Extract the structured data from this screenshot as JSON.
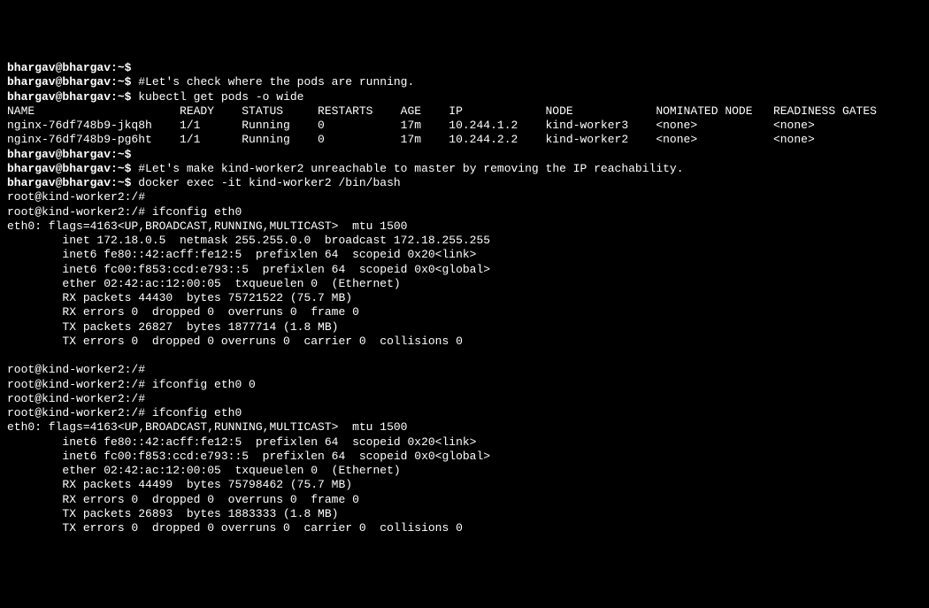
{
  "lines": [
    {
      "type": "prompt",
      "text": "bhargav@bhargav:~$"
    },
    {
      "type": "prompt-cmd",
      "prompt": "bhargav@bhargav:~$",
      "cmd": " #Let's check where the pods are running."
    },
    {
      "type": "prompt-cmd",
      "prompt": "bhargav@bhargav:~$",
      "cmd": " kubectl get pods -o wide"
    },
    {
      "type": "output",
      "text": "NAME                     READY    STATUS     RESTARTS    AGE    IP            NODE            NOMINATED NODE   READINESS GATES"
    },
    {
      "type": "output",
      "text": "nginx-76df748b9-jkq8h    1/1      Running    0           17m    10.244.1.2    kind-worker3    <none>           <none>"
    },
    {
      "type": "output",
      "text": "nginx-76df748b9-pg6ht    1/1      Running    0           17m    10.244.2.2    kind-worker2    <none>           <none>"
    },
    {
      "type": "prompt",
      "text": "bhargav@bhargav:~$"
    },
    {
      "type": "prompt-cmd",
      "prompt": "bhargav@bhargav:~$",
      "cmd": " #Let's make kind-worker2 unreachable to master by removing the IP reachability."
    },
    {
      "type": "prompt-cmd",
      "prompt": "bhargav@bhargav:~$",
      "cmd": " docker exec -it kind-worker2 /bin/bash"
    },
    {
      "type": "output",
      "text": "root@kind-worker2:/#"
    },
    {
      "type": "output",
      "text": "root@kind-worker2:/# ifconfig eth0"
    },
    {
      "type": "output",
      "text": "eth0: flags=4163<UP,BROADCAST,RUNNING,MULTICAST>  mtu 1500"
    },
    {
      "type": "output",
      "text": "        inet 172.18.0.5  netmask 255.255.0.0  broadcast 172.18.255.255"
    },
    {
      "type": "output",
      "text": "        inet6 fe80::42:acff:fe12:5  prefixlen 64  scopeid 0x20<link>"
    },
    {
      "type": "output",
      "text": "        inet6 fc00:f853:ccd:e793::5  prefixlen 64  scopeid 0x0<global>"
    },
    {
      "type": "output",
      "text": "        ether 02:42:ac:12:00:05  txqueuelen 0  (Ethernet)"
    },
    {
      "type": "output",
      "text": "        RX packets 44430  bytes 75721522 (75.7 MB)"
    },
    {
      "type": "output",
      "text": "        RX errors 0  dropped 0  overruns 0  frame 0"
    },
    {
      "type": "output",
      "text": "        TX packets 26827  bytes 1877714 (1.8 MB)"
    },
    {
      "type": "output",
      "text": "        TX errors 0  dropped 0 overruns 0  carrier 0  collisions 0"
    },
    {
      "type": "output",
      "text": " "
    },
    {
      "type": "output",
      "text": "root@kind-worker2:/#"
    },
    {
      "type": "output",
      "text": "root@kind-worker2:/# ifconfig eth0 0"
    },
    {
      "type": "output",
      "text": "root@kind-worker2:/#"
    },
    {
      "type": "output",
      "text": "root@kind-worker2:/# ifconfig eth0"
    },
    {
      "type": "output",
      "text": "eth0: flags=4163<UP,BROADCAST,RUNNING,MULTICAST>  mtu 1500"
    },
    {
      "type": "output",
      "text": "        inet6 fe80::42:acff:fe12:5  prefixlen 64  scopeid 0x20<link>"
    },
    {
      "type": "output",
      "text": "        inet6 fc00:f853:ccd:e793::5  prefixlen 64  scopeid 0x0<global>"
    },
    {
      "type": "output",
      "text": "        ether 02:42:ac:12:00:05  txqueuelen 0  (Ethernet)"
    },
    {
      "type": "output",
      "text": "        RX packets 44499  bytes 75798462 (75.7 MB)"
    },
    {
      "type": "output",
      "text": "        RX errors 0  dropped 0  overruns 0  frame 0"
    },
    {
      "type": "output",
      "text": "        TX packets 26893  bytes 1883333 (1.8 MB)"
    },
    {
      "type": "output",
      "text": "        TX errors 0  dropped 0 overruns 0  carrier 0  collisions 0"
    }
  ]
}
